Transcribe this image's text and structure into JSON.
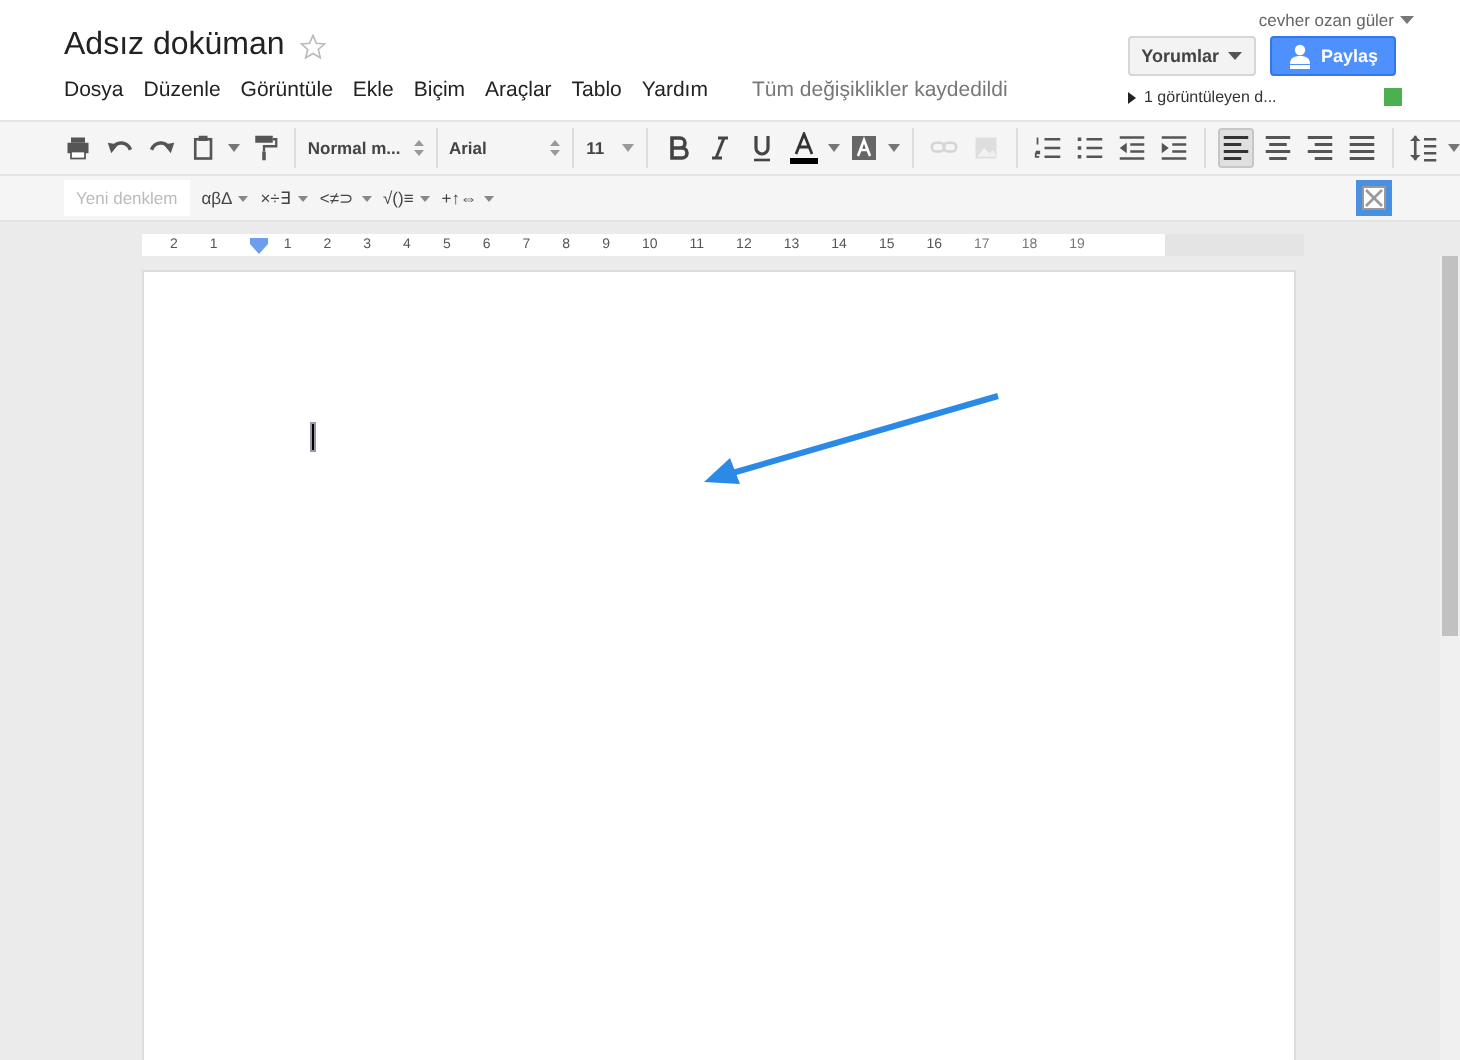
{
  "document": {
    "title": "Adsız doküman",
    "save_status": "Tüm değişiklikler kaydedildi"
  },
  "menu": [
    "Dosya",
    "Düzenle",
    "Görüntüle",
    "Ekle",
    "Biçim",
    "Araçlar",
    "Tablo",
    "Yardım"
  ],
  "account": {
    "user": "cevher ozan güler",
    "comments_button": "Yorumlar",
    "share_button": "Paylaş",
    "viewers": "1 görüntüleyen d..."
  },
  "toolbar": {
    "style": "Normal m...",
    "font": "Arial",
    "size": "11",
    "insert_buttons": [
      {
        "disabled": true
      },
      {
        "disabled": true
      }
    ],
    "alignment": [
      {
        "selected": true
      },
      {
        "selected": false
      },
      {
        "selected": false
      },
      {
        "selected": false
      }
    ]
  },
  "equation_bar": {
    "new_equation": "Yeni denklem",
    "new_equation_disabled": true,
    "symbol_groups": [
      "αβΔ",
      "×÷∃",
      "<≠⊃",
      "√()≡",
      "+↑⇔"
    ]
  },
  "ruler": {
    "labels": [
      "2",
      "1",
      "1",
      "2",
      "3",
      "4",
      "5",
      "6",
      "7",
      "8",
      "9",
      "10",
      "11",
      "12",
      "13",
      "14",
      "15",
      "16",
      "17",
      "18",
      "19"
    ]
  }
}
